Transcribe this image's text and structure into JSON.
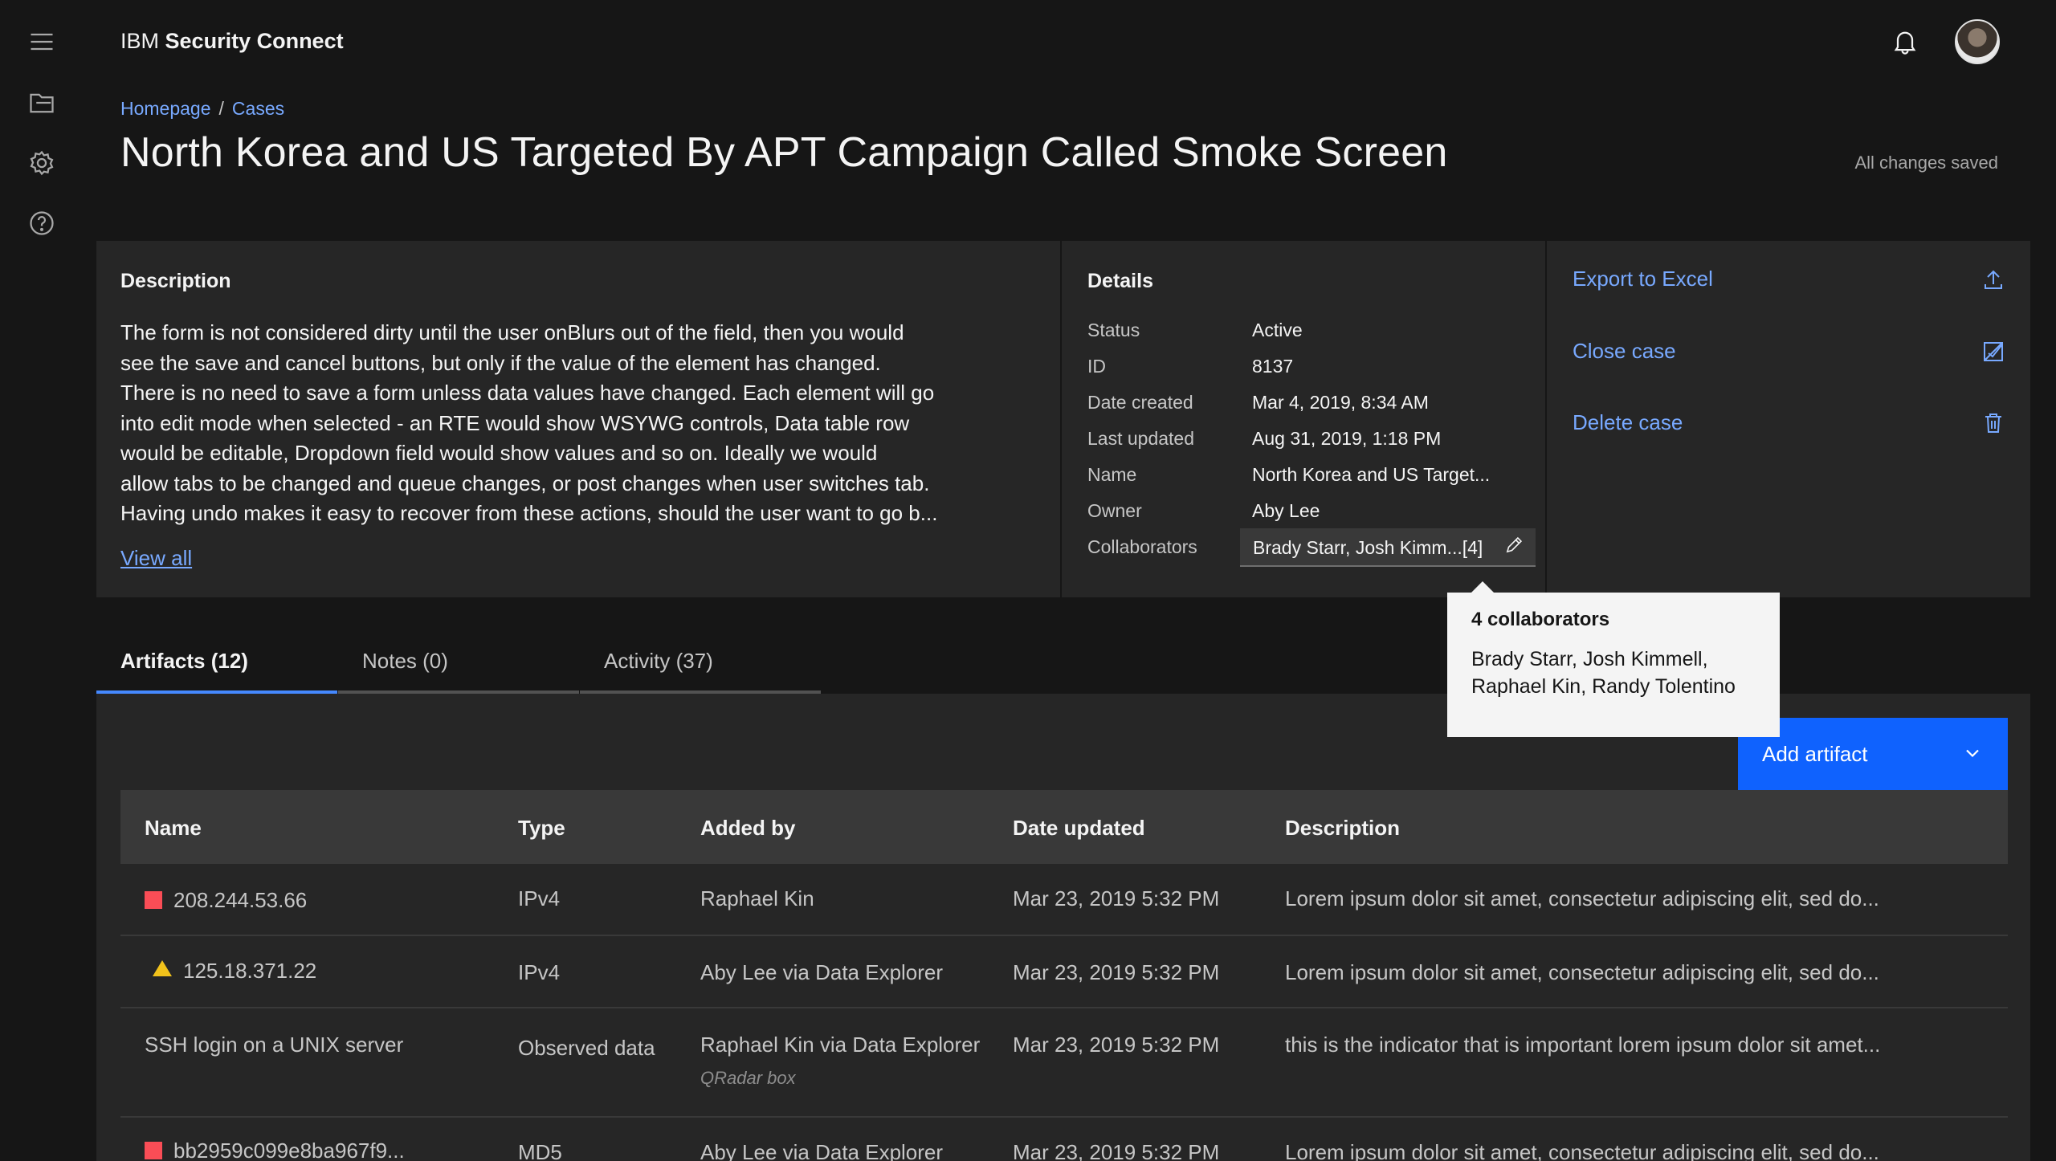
{
  "app": {
    "brand_prefix": "IBM",
    "brand_name": "Security Connect"
  },
  "breadcrumb": [
    {
      "label": "Homepage"
    },
    {
      "label": "Cases"
    }
  ],
  "breadcrumb_sep": "/",
  "page_title": "North Korea and US Targeted By APT Campaign Called Smoke Screen",
  "save_status": "All changes saved",
  "description": {
    "title": "Description",
    "lines": [
      "The form is not considered dirty until the user onBlurs out of the field, then you would",
      "see the save and cancel buttons, but only if the value of the element has changed.",
      "There is no need to save a form unless data values have changed.  Each element will go",
      "into edit mode when selected - an RTE would show WSYWG controls, Data table row",
      "would be editable, Dropdown field would show values and so on.  Ideally we would",
      "allow tabs to be changed and queue changes, or post changes when user switches tab.",
      "Having undo makes it easy to recover from these actions, should the user want to go b..."
    ],
    "view_all": "View all"
  },
  "details": {
    "title": "Details",
    "rows": [
      {
        "key": "Status",
        "value": "Active"
      },
      {
        "key": "ID",
        "value": "8137"
      },
      {
        "key": "Date created",
        "value": "Mar 4, 2019, 8:34 AM"
      },
      {
        "key": "Last updated",
        "value": "Aug 31, 2019, 1:18 PM"
      },
      {
        "key": "Name",
        "value": "North Korea and US Target..."
      },
      {
        "key": "Owner",
        "value": "Aby Lee"
      },
      {
        "key": "Collaborators",
        "value": "Brady Starr, Josh Kimm...[4]"
      }
    ]
  },
  "actions": [
    {
      "label": "Export to Excel",
      "icon": "upload-icon"
    },
    {
      "label": "Close case",
      "icon": "close-case-icon"
    },
    {
      "label": "Delete case",
      "icon": "trash-icon"
    }
  ],
  "tooltip": {
    "title": "4 collaborators",
    "line1": "Brady Starr, Josh Kimmell,",
    "line2": "Raphael Kin, Randy Tolentino"
  },
  "tabs": [
    {
      "label": "Artifacts (12)",
      "active": true
    },
    {
      "label": "Notes (0)",
      "active": false
    },
    {
      "label": "Activity (37)",
      "active": false
    }
  ],
  "add_artifact": "Add artifact",
  "table": {
    "headers": [
      "Name",
      "Type",
      "Added by",
      "Date updated",
      "Description"
    ],
    "rows": [
      {
        "severity": "high",
        "name": "208.244.53.66",
        "type": "IPv4",
        "added_by": "Raphael Kin",
        "added_sub": "",
        "date": "Mar 23, 2019 5:32 PM",
        "description": "Lorem ipsum dolor sit amet, consectetur adipiscing elit, sed do..."
      },
      {
        "severity": "medium",
        "name": "125.18.371.22",
        "type": "IPv4",
        "added_by": "Aby Lee via Data Explorer",
        "added_sub": "",
        "date": "Mar 23, 2019 5:32 PM",
        "description": "Lorem ipsum dolor sit amet, consectetur adipiscing elit, sed do..."
      },
      {
        "severity": "none",
        "name": "SSH login on a UNIX server",
        "type": "Observed data",
        "added_by": "Raphael Kin via Data Explorer",
        "added_sub": "QRadar box",
        "date": "Mar 23, 2019 5:32 PM",
        "description": "this is the indicator that is important lorem ipsum dolor sit amet..."
      },
      {
        "severity": "high",
        "name": "bb2959c099e8ba967f9...",
        "type": "MD5",
        "added_by": "Aby Lee via Data Explorer",
        "added_sub": "",
        "date": "Mar 23, 2019 5:32 PM",
        "description": "Lorem ipsum dolor sit amet, consectetur adipiscing elit, sed do..."
      }
    ]
  },
  "colors": {
    "accent": "#0f62fe",
    "link": "#78a9ff",
    "sev_high": "#fa4d56",
    "sev_medium": "#f1c21b"
  }
}
